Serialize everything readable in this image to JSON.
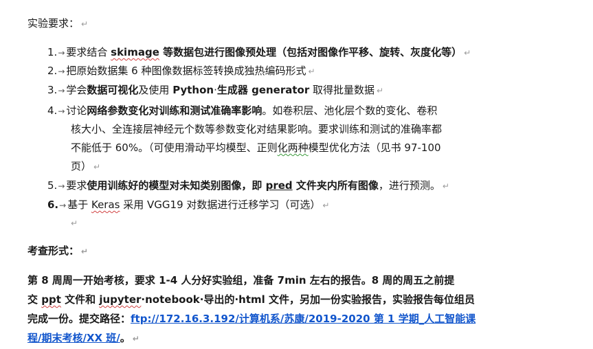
{
  "heading": "实验要求：",
  "items": [
    {
      "num": "1.",
      "parts": [
        {
          "t": "要求结合 "
        },
        {
          "t": "skimage",
          "b": true,
          "sq": true
        },
        {
          "t": " 等数据包进行图像预处理（包括对图像作平移、旋转、灰度化等）",
          "b": true
        }
      ]
    },
    {
      "num": "2.",
      "parts": [
        {
          "t": "把原始数据集 6 种图像数据标签转换成独热编码形式"
        }
      ]
    },
    {
      "num": "3.",
      "parts": [
        {
          "t": "学会"
        },
        {
          "t": "数据可视化",
          "b": true
        },
        {
          "t": "及使用 "
        },
        {
          "t": "Python",
          "b": true
        },
        {
          "t": "·"
        },
        {
          "t": "生成器 generator",
          "b": true
        },
        {
          "t": " 取得批量数据"
        }
      ]
    },
    {
      "num": "4.",
      "lines": [
        [
          {
            "t": "讨论"
          },
          {
            "t": "网络参数变化对训练和测试准确率影响",
            "b": true
          },
          {
            "t": "。如卷积层、池化层个数的变化、卷积"
          }
        ],
        [
          {
            "t": "核大小、全连接层神经元个数等参数变化对结果影响。要求训练和测试的准确率都"
          }
        ],
        [
          {
            "t": "不能低于 60%。（可使用滑动平均模型、正则"
          },
          {
            "t": "化两种",
            "sqg": true
          },
          {
            "t": "模型优化方法（见书 97-100"
          }
        ],
        [
          {
            "t": "页）"
          }
        ]
      ]
    },
    {
      "num": "5.",
      "parts": [
        {
          "t": "要求"
        },
        {
          "t": "使用训练好的模型对未知类别图像，即 ",
          "b": true
        },
        {
          "t": "pred",
          "b": true,
          "u": true
        },
        {
          "t": " 文件夹内所有图像",
          "b": true
        },
        {
          "t": "，进行预测。"
        }
      ]
    },
    {
      "num": "6.",
      "numBold": true,
      "parts": [
        {
          "t": "基于 "
        },
        {
          "t": "Keras",
          "sq": true
        },
        {
          "t": " 采用 VGG19 对数据进行迁移学习（可选）"
        }
      ]
    }
  ],
  "section2_title": "考查形式：",
  "para": {
    "line1": "第 8 周周一开始考核，要求 1-4 人分好实验组，准备 7min 左右的报告。8 周的周五之前提",
    "line2_a": "交 ",
    "line2_ppt": "ppt",
    "line2_b": " 文件和 ",
    "line2_jup": "jupyter",
    "line2_c": "·notebook",
    "line2_d": "·导出的·html 文件，另加一份实验报告，实验报告每位组员",
    "line3_a": "完成一份。提交路径：",
    "link_part1": "ftp://172.16.3.192/计算机系/苏康/2019-2020 第 1 学期_人工智能课",
    "link_part2": "程/期末考核/XX 班/",
    "line4_end": "。"
  },
  "marks": {
    "para_mark": "↵",
    "arrow": "→"
  }
}
